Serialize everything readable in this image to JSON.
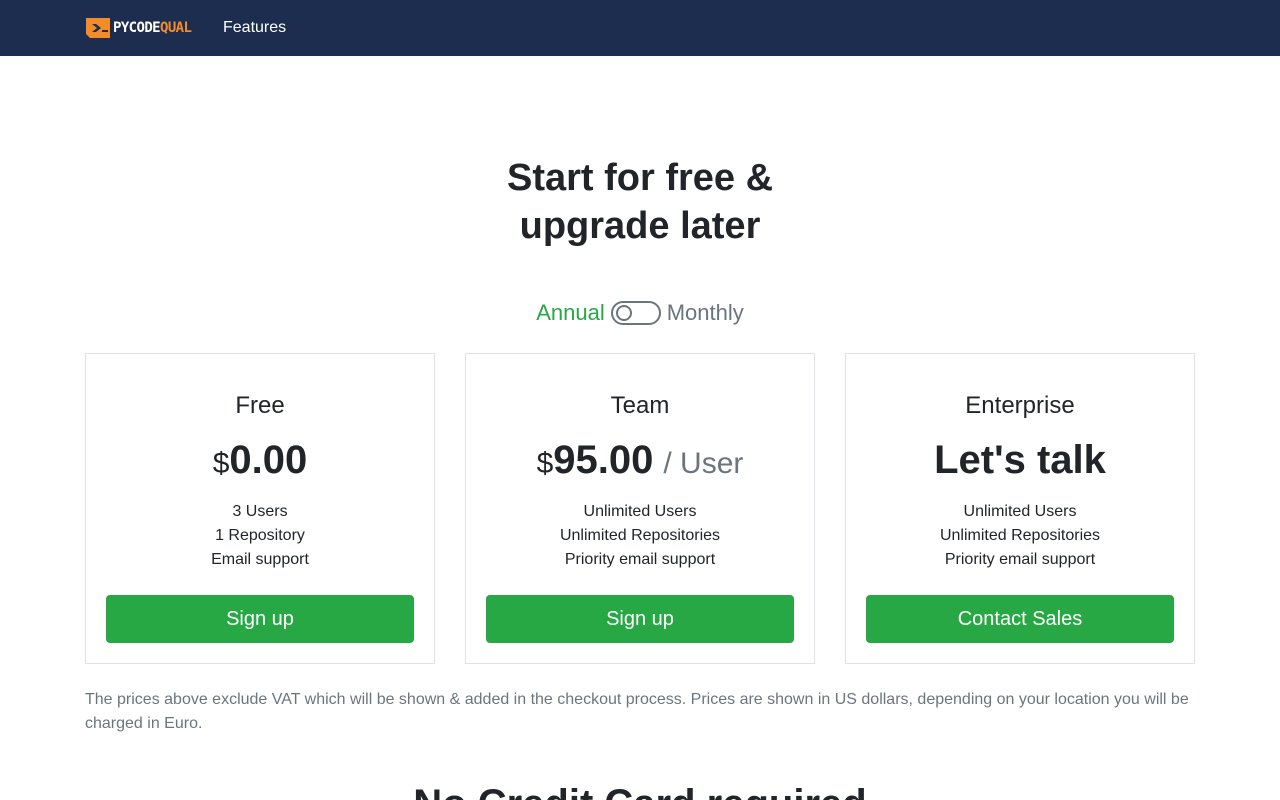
{
  "nav": {
    "brand_part1": "PYCODE",
    "brand_part2": "QUAL",
    "brand_icon": "pycodequal-logo-icon",
    "features_link": "Features"
  },
  "hero": {
    "line1": "Start for free &",
    "line2": "upgrade later"
  },
  "billing_toggle": {
    "annual_label": "Annual",
    "monthly_label": "Monthly",
    "monthly_selected": false
  },
  "plans": [
    {
      "name": "Free",
      "currency": "$",
      "amount": "0.00",
      "features": [
        "3 Users",
        "1 Repository",
        "Email support"
      ],
      "cta": "Sign up"
    },
    {
      "name": "Team",
      "currency": "$",
      "amount": "95.00",
      "per": "/ User",
      "features": [
        "Unlimited Users",
        "Unlimited Repositories",
        "Priority email support"
      ],
      "cta": "Sign up"
    },
    {
      "name": "Enterprise",
      "price_text": "Let's talk",
      "features": [
        "Unlimited Users",
        "Unlimited Repositories",
        "Priority email support"
      ],
      "cta": "Contact Sales"
    }
  ],
  "footnote": "The prices above exclude VAT which will be shown & added in the checkout process. Prices are shown in US dollars, depending on your location you will be charged in Euro.",
  "next_section_title": "No Credit Card required",
  "colors": {
    "navbar": "#1d2d50",
    "accent_green": "#28a745",
    "brand_orange": "#f28c28",
    "muted_text": "#6c757d"
  }
}
